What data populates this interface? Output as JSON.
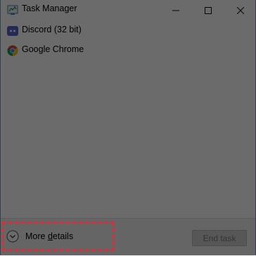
{
  "window": {
    "title": "Task Manager",
    "controls": {
      "minimize": "minimize-icon",
      "maximize": "maximize-icon",
      "close": "close-icon"
    }
  },
  "apps": [
    {
      "label": "Discord (32 bit)",
      "icon": "discord-icon"
    },
    {
      "label": "Google Chrome",
      "icon": "chrome-icon"
    }
  ],
  "footer": {
    "more_details_prefix": "More ",
    "more_details_underlined": "d",
    "more_details_suffix": "etails",
    "end_task": "End task"
  },
  "colors": {
    "highlight": "#d8303a",
    "overlay": "rgba(0,0,0,0.58)"
  }
}
